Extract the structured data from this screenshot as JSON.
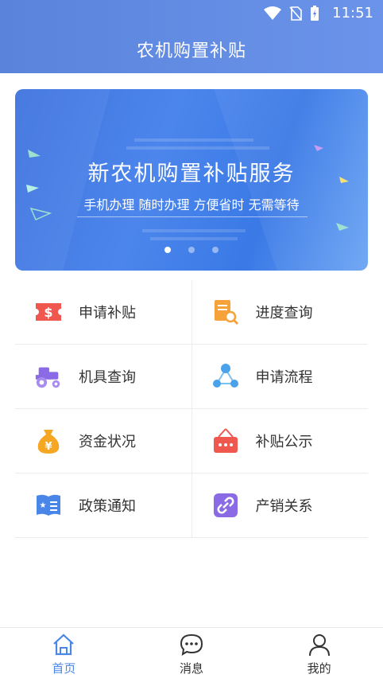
{
  "status_bar": {
    "time": "11:51"
  },
  "header": {
    "title": "农机购置补贴"
  },
  "banner": {
    "headline": "新农机购置补贴服务",
    "subline": "手机办理 随时办理 方便省时 无需等待",
    "slide_count": 3,
    "active_slide": 1
  },
  "menu": [
    {
      "label": "申请补贴",
      "icon": "money-ticket-icon",
      "color": "#f0574f"
    },
    {
      "label": "进度查询",
      "icon": "document-search-icon",
      "color": "#f5a23a"
    },
    {
      "label": "机具查询",
      "icon": "tractor-icon",
      "color": "#8b6ae6"
    },
    {
      "label": "申请流程",
      "icon": "flow-nodes-icon",
      "color": "#4aa3ea"
    },
    {
      "label": "资金状况",
      "icon": "money-bag-icon",
      "color": "#f5a623"
    },
    {
      "label": "补贴公示",
      "icon": "notice-board-icon",
      "color": "#f0574f"
    },
    {
      "label": "政策通知",
      "icon": "policy-book-icon",
      "color": "#4a86e8"
    },
    {
      "label": "产销关系",
      "icon": "link-icon",
      "color": "#8b6ae6"
    }
  ],
  "tabbar": [
    {
      "label": "首页",
      "icon": "home-icon",
      "active": true
    },
    {
      "label": "消息",
      "icon": "message-icon",
      "active": false
    },
    {
      "label": "我的",
      "icon": "user-icon",
      "active": false
    }
  ],
  "colors": {
    "header": "#5a84dc",
    "accent": "#4a86e8"
  }
}
